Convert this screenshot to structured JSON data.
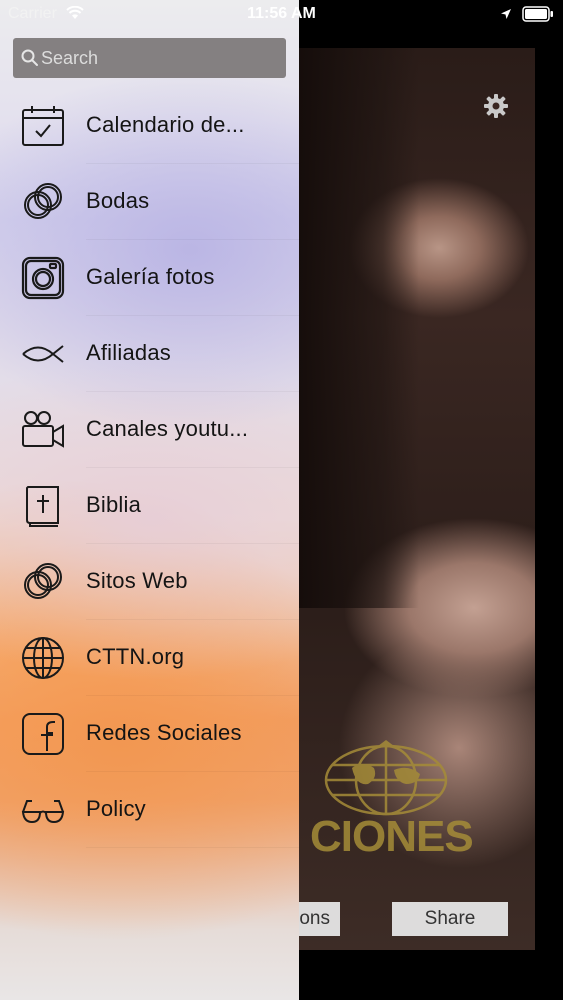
{
  "status_bar": {
    "carrier": "Carrier",
    "time": "11:56 AM"
  },
  "search": {
    "placeholder": "Search"
  },
  "menu": {
    "items": [
      {
        "label": "Calendario de...",
        "icon": "calendar-icon"
      },
      {
        "label": "Bodas",
        "icon": "rings-icon"
      },
      {
        "label": "Galería fotos",
        "icon": "camera-icon"
      },
      {
        "label": "Afiliadas",
        "icon": "fish-icon"
      },
      {
        "label": "Canales youtu...",
        "icon": "video-camera-icon"
      },
      {
        "label": "Biblia",
        "icon": "bible-icon"
      },
      {
        "label": "Sitos Web",
        "icon": "links-icon"
      },
      {
        "label": "CTTN.org",
        "icon": "globe-icon"
      },
      {
        "label": "Redes Sociales",
        "icon": "facebook-icon"
      },
      {
        "label": "Policy",
        "icon": "glasses-icon"
      }
    ]
  },
  "background": {
    "logo_text": "CIONES",
    "options_label": "ons",
    "share_label": "Share"
  },
  "colors": {
    "menu_text": "#141414",
    "search_bg": "#6e6969",
    "logo_gold": "#a58c38"
  }
}
